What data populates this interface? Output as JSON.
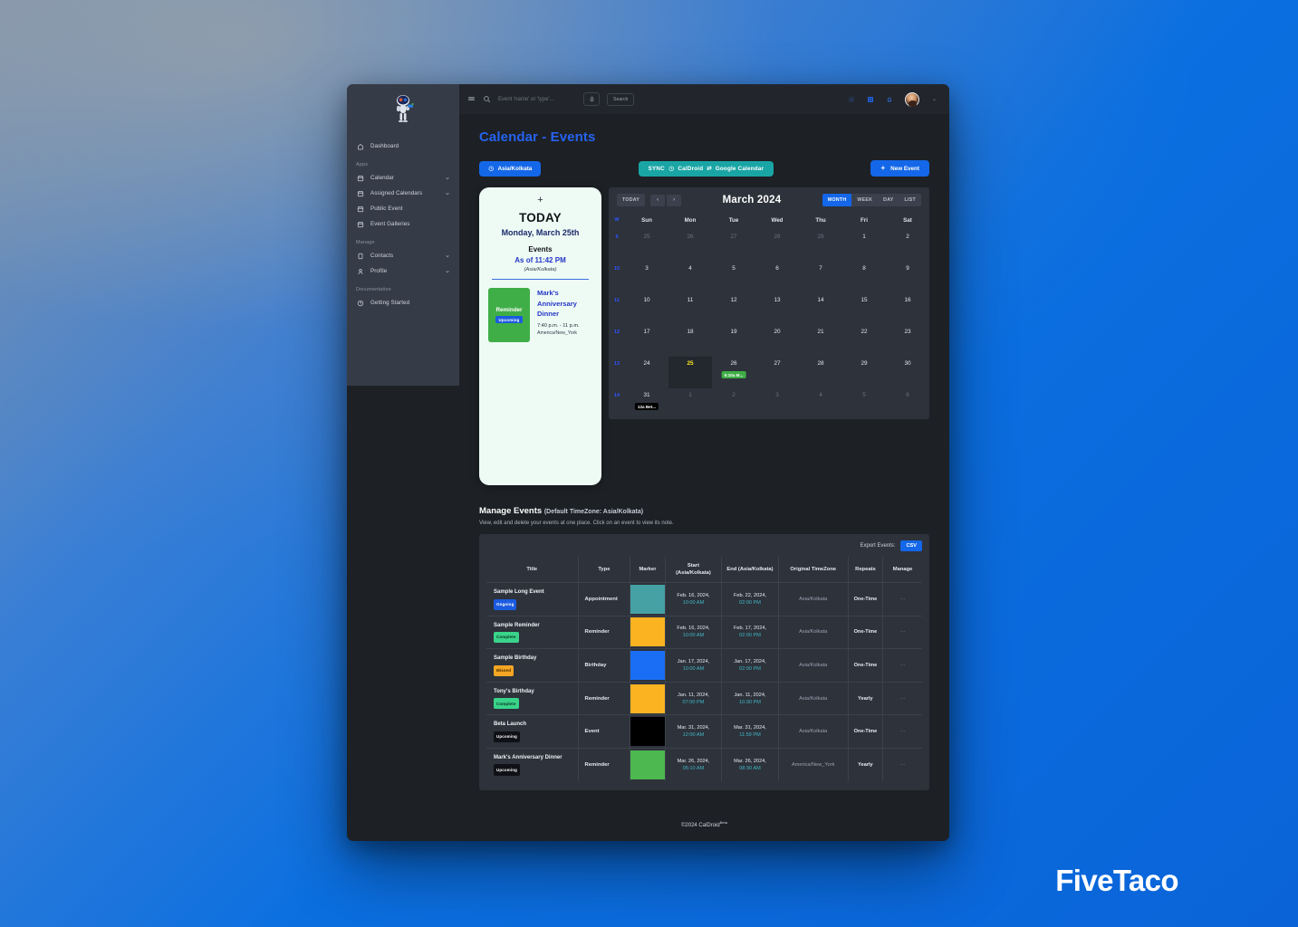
{
  "sidebar": {
    "brand_icon": "droid-mascot-icon",
    "top_items": [
      {
        "label": "Dashboard",
        "icon": "home-icon",
        "expandable": false
      }
    ],
    "groups": [
      {
        "label": "Apps",
        "items": [
          {
            "label": "Calendar",
            "icon": "calendar-icon",
            "expandable": true
          },
          {
            "label": "Assigned Calendars",
            "icon": "calendar-icon",
            "expandable": true
          },
          {
            "label": "Public Event",
            "icon": "calendar-icon",
            "expandable": false
          },
          {
            "label": "Event Galleries",
            "icon": "calendar-icon",
            "expandable": false
          }
        ]
      },
      {
        "label": "Manage",
        "items": [
          {
            "label": "Contacts",
            "icon": "contact-card-icon",
            "expandable": true
          },
          {
            "label": "Profile",
            "icon": "user-icon",
            "expandable": true
          }
        ]
      },
      {
        "label": "Documentation",
        "items": [
          {
            "label": "Getting Started",
            "icon": "help-circle-icon",
            "expandable": false
          }
        ]
      }
    ]
  },
  "topbar": {
    "menu_icon": "hamburger-icon",
    "search_icon": "search-icon",
    "search_placeholder": "Event 'name' or 'type'...",
    "search_value": "",
    "mic_icon": "microphone-icon",
    "search_button": "Search",
    "right_icons": [
      {
        "name": "brightness-icon",
        "color": "#2b4a8f"
      },
      {
        "name": "apps-grid-icon",
        "color": "#1f63e8"
      },
      {
        "name": "bell-icon",
        "color": "#2f6ad6"
      }
    ],
    "avatar_name": "user-avatar",
    "caret": "⌄"
  },
  "page": {
    "title": "Calendar - Events"
  },
  "actions": {
    "timezone_button": "Asia/Kolkata",
    "timezone_icon": "clock-icon",
    "sync_prefix": "SYNC",
    "sync_icon": "clock-icon",
    "sync_source": "CalDroid",
    "sync_arrows": "⇄",
    "sync_target": "Google  Calendar",
    "new_event_button": "New Event",
    "new_event_icon": "plus-icon"
  },
  "today_card": {
    "plus_icon": "plus-icon",
    "heading": "TODAY",
    "date": "Monday, March 25th",
    "events_label": "Events",
    "as_of": "As of 11:42 PM",
    "timezone": "(Asia/Kolkata)",
    "items": [
      {
        "type": "Reminder",
        "status": "Upcoming",
        "color": "#3fae47",
        "title": "Mark's Anniversary Dinner",
        "time": "7:40 p.m.  -  11 p.m.",
        "zone": "America/New_York"
      }
    ]
  },
  "calendar": {
    "today_button": "TODAY",
    "prev_icon": "chevron-left-icon",
    "next_icon": "chevron-right-icon",
    "prev_label": "‹",
    "next_label": "›",
    "month_title": "March 2024",
    "views": [
      {
        "label": "MONTH",
        "active": true
      },
      {
        "label": "WEEK",
        "active": false
      },
      {
        "label": "DAY",
        "active": false
      },
      {
        "label": "LIST",
        "active": false
      }
    ],
    "week_col_header": "W",
    "day_headers": [
      "Sun",
      "Mon",
      "Tue",
      "Wed",
      "Thu",
      "Fri",
      "Sat"
    ],
    "weeks": [
      {
        "week": "9",
        "days": [
          {
            "n": "25",
            "out": true
          },
          {
            "n": "26",
            "out": true
          },
          {
            "n": "27",
            "out": true
          },
          {
            "n": "28",
            "out": true
          },
          {
            "n": "29",
            "out": true
          },
          {
            "n": "1",
            "out": false
          },
          {
            "n": "2",
            "out": false
          }
        ]
      },
      {
        "week": "10",
        "days": [
          {
            "n": "3"
          },
          {
            "n": "4"
          },
          {
            "n": "5"
          },
          {
            "n": "6"
          },
          {
            "n": "7"
          },
          {
            "n": "8"
          },
          {
            "n": "9"
          }
        ]
      },
      {
        "week": "11",
        "days": [
          {
            "n": "10"
          },
          {
            "n": "11"
          },
          {
            "n": "12"
          },
          {
            "n": "13"
          },
          {
            "n": "14"
          },
          {
            "n": "15"
          },
          {
            "n": "16"
          }
        ]
      },
      {
        "week": "12",
        "days": [
          {
            "n": "17"
          },
          {
            "n": "18"
          },
          {
            "n": "19"
          },
          {
            "n": "20"
          },
          {
            "n": "21"
          },
          {
            "n": "22"
          },
          {
            "n": "23"
          }
        ]
      },
      {
        "week": "13",
        "days": [
          {
            "n": "24"
          },
          {
            "n": "25",
            "today": true
          },
          {
            "n": "26",
            "chip": {
              "text": "5:10a M...",
              "color": "green"
            }
          },
          {
            "n": "27"
          },
          {
            "n": "28"
          },
          {
            "n": "29"
          },
          {
            "n": "30"
          }
        ]
      },
      {
        "week": "14",
        "days": [
          {
            "n": "31",
            "chip": {
              "text": "12a Bet...",
              "color": "black"
            }
          },
          {
            "n": "1",
            "out": true
          },
          {
            "n": "2",
            "out": true
          },
          {
            "n": "3",
            "out": true
          },
          {
            "n": "4",
            "out": true
          },
          {
            "n": "5",
            "out": true
          },
          {
            "n": "6",
            "out": true
          }
        ]
      }
    ]
  },
  "manage": {
    "title": "Manage Events",
    "title_sub": "(Default TimeZone: Asia/Kolkata)",
    "description": "View, edit and delete your events at one place. Click on an event to view its note.",
    "export_label": "Export Events:",
    "export_button": "CSV",
    "columns": [
      "Title",
      "Type",
      "Marker",
      "Start (Asia/Kolkata)",
      "End (Asia/Kolkata)",
      "Original TimeZone",
      "Repeats",
      "Manage"
    ],
    "column_start_l1": "Start",
    "column_start_l2": "(Asia/Kolkata)",
    "rows": [
      {
        "title": "Sample Long Event",
        "status": "Ongoing",
        "status_class": "b-ongoing",
        "type": "Appointment",
        "marker": "#46a1a5",
        "start_date": "Feb. 16, 2024,",
        "start_time": "10:00 AM",
        "end_date": "Feb. 22, 2024,",
        "end_time": "02:00 PM",
        "tz": "Asia/Kolkata",
        "repeats": "One-Time",
        "manage": "···"
      },
      {
        "title": "Sample Reminder",
        "status": "Complete",
        "status_class": "b-complete",
        "type": "Reminder",
        "marker": "#fcb322",
        "start_date": "Feb. 16, 2024,",
        "start_time": "10:00 AM",
        "end_date": "Feb. 17, 2024,",
        "end_time": "02:00 PM",
        "tz": "Asia/Kolkata",
        "repeats": "One-Time",
        "manage": "···"
      },
      {
        "title": "Sample Birthday",
        "status": "Missed",
        "status_class": "b-missed",
        "type": "Birthday",
        "marker": "#1a6ef5",
        "start_date": "Jan. 17, 2024,",
        "start_time": "10:00 AM",
        "end_date": "Jan. 17, 2024,",
        "end_time": "02:00 PM",
        "tz": "Asia/Kolkata",
        "repeats": "One-Time",
        "manage": "···"
      },
      {
        "title": "Tony's Birthday",
        "status": "Complete",
        "status_class": "b-complete",
        "type": "Reminder",
        "marker": "#fcb322",
        "start_date": "Jan. 11, 2024,",
        "start_time": "07:00 PM",
        "end_date": "Jan. 11, 2024,",
        "end_time": "10:30 PM",
        "tz": "Asia/Kolkata",
        "repeats": "Yearly",
        "manage": "···"
      },
      {
        "title": "Beta Launch",
        "status": "Upcoming",
        "status_class": "b-upcoming",
        "type": "Event",
        "marker": "#000000",
        "start_date": "Mar. 31, 2024,",
        "start_time": "12:00 AM",
        "end_date": "Mar. 31, 2024,",
        "end_time": "11:59 PM",
        "tz": "Asia/Kolkata",
        "repeats": "One-Time",
        "manage": "···"
      },
      {
        "title": "Mark's Anniversary Dinner",
        "status": "Upcoming",
        "status_class": "b-upcoming",
        "type": "Reminder",
        "marker": "#4cb84f",
        "start_date": "Mar. 26, 2024,",
        "start_time": "05:10 AM",
        "end_date": "Mar. 26, 2024,",
        "end_time": "08:30 AM",
        "tz": "America/New_York",
        "repeats": "Yearly",
        "manage": "···"
      }
    ]
  },
  "footer": {
    "text": "©2024 CalDroid",
    "sup": "Beta"
  },
  "watermark": {
    "text": "FiveTaco"
  },
  "colors": {
    "accent_blue": "#1467e8",
    "sync_teal": "#1aa5a5",
    "title_blue": "#2563f0",
    "today_yellow": "#ffe922",
    "page_bg": "#0a64d8"
  }
}
